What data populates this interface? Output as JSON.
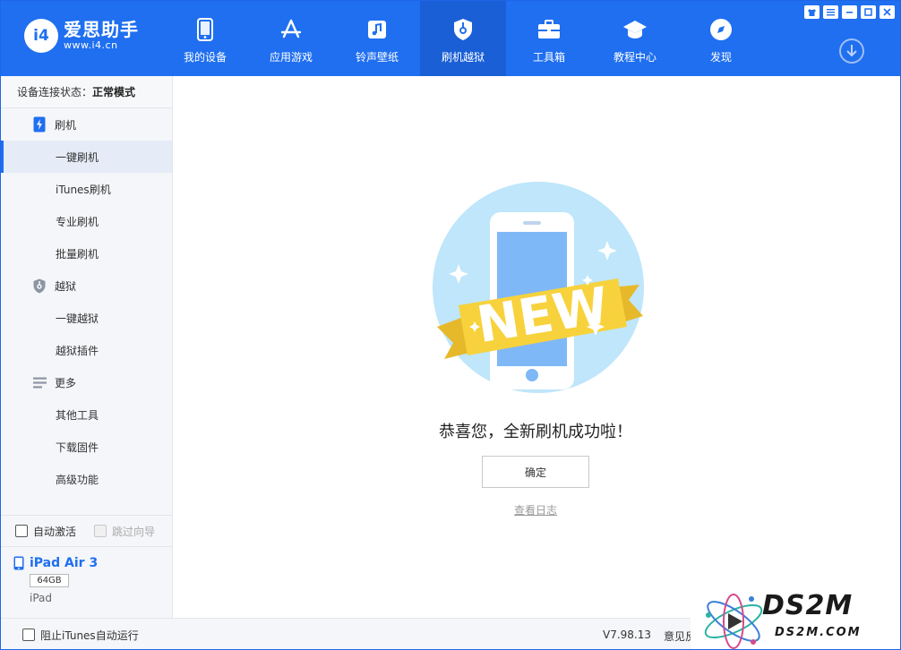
{
  "brand": {
    "name": "爱思助手",
    "url": "www.i4.cn",
    "badge": "i4"
  },
  "nav": [
    {
      "label": "我的设备",
      "icon": "phone-icon"
    },
    {
      "label": "应用游戏",
      "icon": "app-store-icon"
    },
    {
      "label": "铃声壁纸",
      "icon": "music-icon"
    },
    {
      "label": "刷机越狱",
      "icon": "shield-key-icon",
      "active": true
    },
    {
      "label": "工具箱",
      "icon": "toolbox-icon"
    },
    {
      "label": "教程中心",
      "icon": "graduation-cap-icon"
    },
    {
      "label": "发现",
      "icon": "compass-icon"
    }
  ],
  "sidebar": {
    "conn_label": "设备连接状态：",
    "conn_value": "正常模式",
    "groups": [
      {
        "label": "刷机",
        "icon": "flash-phone-icon",
        "items": [
          "一键刷机",
          "iTunes刷机",
          "专业刷机",
          "批量刷机"
        ]
      },
      {
        "label": "越狱",
        "icon": "shield-icon",
        "items": [
          "一键越狱",
          "越狱插件"
        ]
      },
      {
        "label": "更多",
        "icon": "list-icon",
        "items": [
          "其他工具",
          "下载固件",
          "高级功能"
        ]
      }
    ],
    "active_item": "一键刷机",
    "auto_activate": "自动激活",
    "skip_guide": "跳过向导",
    "device": {
      "name": "iPad Air 3",
      "capacity": "64GB",
      "type": "iPad"
    }
  },
  "main": {
    "badge_text": "NEW",
    "success_text": "恭喜您，全新刷机成功啦！",
    "ok_label": "确定",
    "log_label": "查看日志"
  },
  "bottom": {
    "block_itunes": "阻止iTunes自动运行",
    "version": "V7.98.13",
    "feedback": "意见反馈"
  },
  "watermark": {
    "big": "DS2M",
    "small": "DS2M.COM"
  },
  "colors": {
    "primary": "#1f6ff0",
    "active_nav": "#1a5fd6",
    "sidebar_bg": "#f4f6f9",
    "ribbon": "#f7d23c"
  }
}
